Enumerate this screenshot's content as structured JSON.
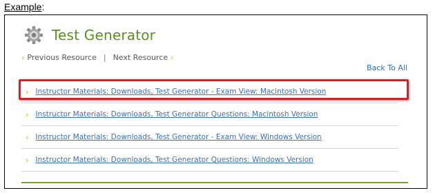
{
  "caption": {
    "label": "Example",
    "suffix": ":"
  },
  "header": {
    "title": "Test Generator",
    "icon": "gear-icon"
  },
  "nav": {
    "previous": "Previous Resource",
    "separator": "|",
    "next": "Next Resource"
  },
  "back_link": "Back To All",
  "resources": [
    "Instructor Materials: Downloads, Test Generator - Exam View: Macintosh Version",
    "Instructor Materials: Downloads, Test Generator Questions: Macintosh Version",
    "Instructor Materials: Downloads, Test Generator - Exam View: Windows Version",
    "Instructor Materials: Downloads, Test Generator Questions: Windows Version"
  ],
  "colors": {
    "title": "#5a8f1a",
    "link": "#3b6fb6",
    "chevron": "#f39c12",
    "highlight": "#d71f27",
    "bottom_bar": "#6fa52b"
  }
}
